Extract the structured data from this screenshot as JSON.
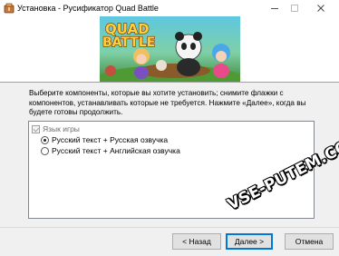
{
  "window": {
    "title": "Установка - Русификатор Quad Battle",
    "app_icon": "installer-icon",
    "controls": {
      "minimize": "minimize-icon",
      "maximize": "maximize-icon",
      "close": "close-icon"
    }
  },
  "banner": {
    "logo_line1": "QUAD",
    "logo_line2": "BATTLE"
  },
  "description": "Выберите компоненты, которые вы хотите установить; снимите флажки с компонентов, устанавливать которые не требуется. Нажмите «Далее», когда вы будете готовы продолжить.",
  "components": {
    "group_label": "Язык игры",
    "group_checked": true,
    "options": [
      {
        "label": "Русский текст + Русская озвучка",
        "selected": true
      },
      {
        "label": "Русский текст + Английская озвучка",
        "selected": false
      }
    ]
  },
  "watermark": "VSE-PUTEM.COM",
  "buttons": {
    "back": "< Назад",
    "next": "Далее >",
    "cancel": "Отмена"
  },
  "colors": {
    "accent": "#0078d7",
    "list_border": "#828790",
    "button_face": "#e1e1e1"
  }
}
